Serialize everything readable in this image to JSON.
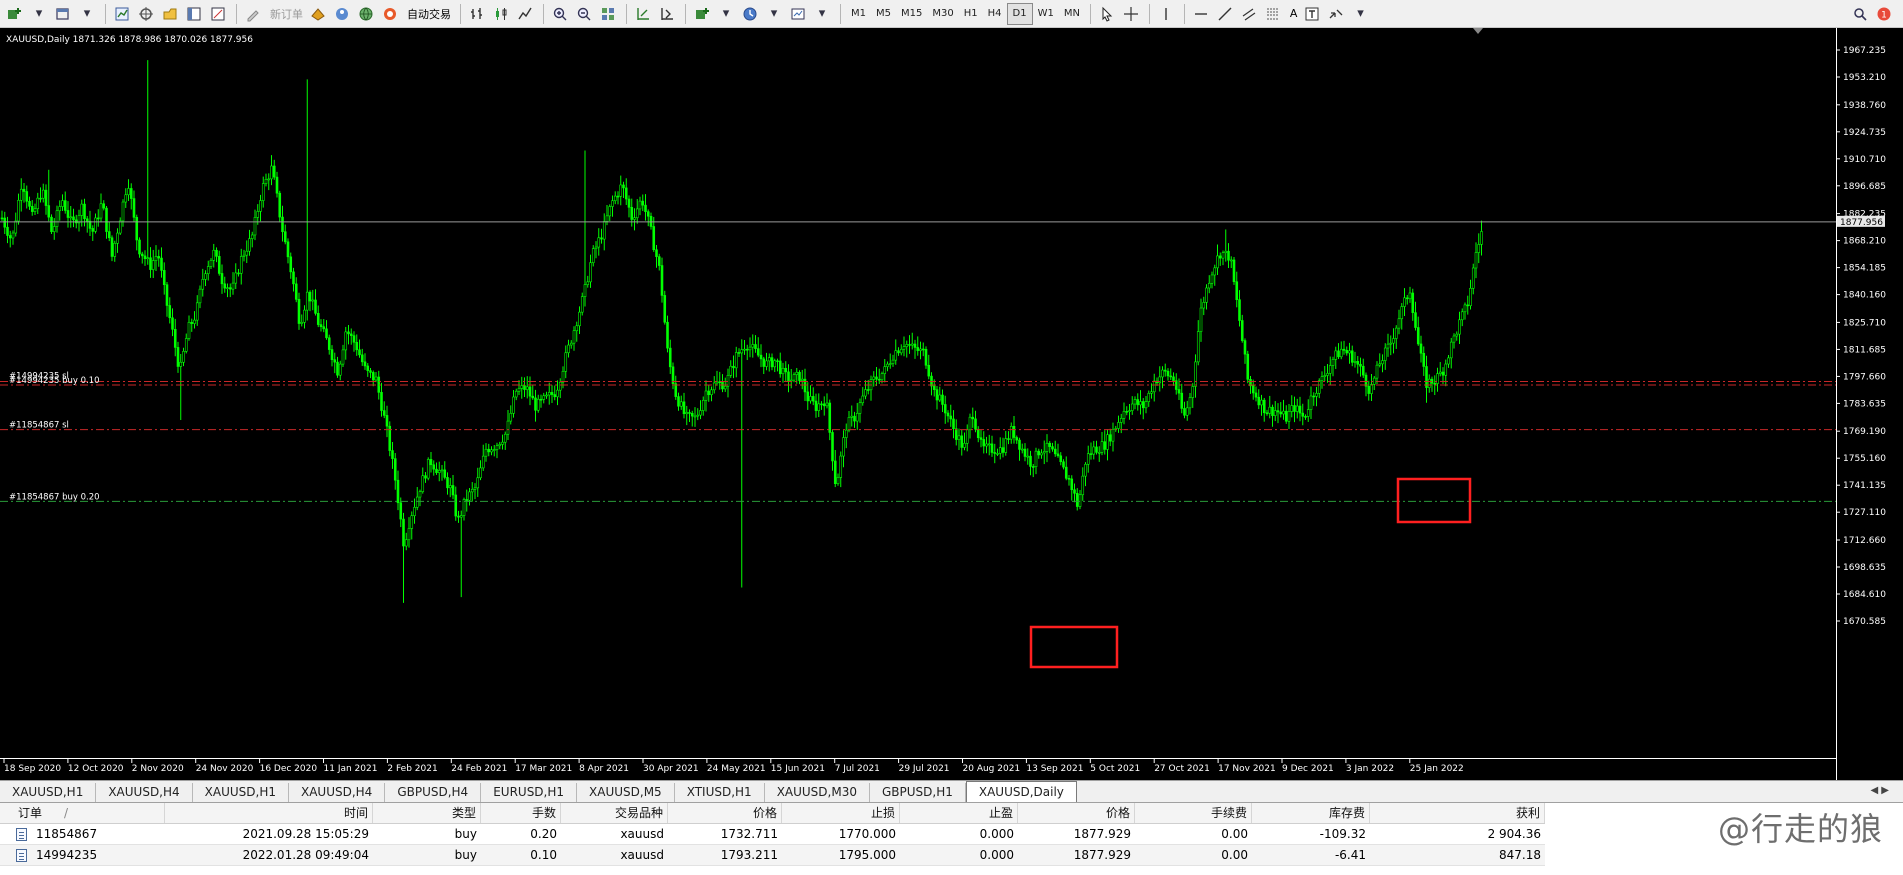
{
  "toolbar": {
    "new_order_label": "新订单",
    "auto_trading_label": "自动交易",
    "timeframes": [
      "M1",
      "M5",
      "M15",
      "M30",
      "H1",
      "H4",
      "D1",
      "W1",
      "MN"
    ],
    "active_timeframe": "D1",
    "text_tool_label": "A"
  },
  "chart": {
    "header": "XAUUSD,Daily  1871.326 1878.986 1870.026 1877.956",
    "current_price": "1877.956",
    "price_labels": [
      "1967.235",
      "1953.210",
      "1938.760",
      "1924.735",
      "1910.710",
      "1896.685",
      "1882.235",
      "1868.210",
      "1854.185",
      "1840.160",
      "1825.710",
      "1811.685",
      "1797.660",
      "1783.635",
      "1769.190",
      "1755.160",
      "1741.135",
      "1727.110",
      "1712.660",
      "1698.635",
      "1684.610",
      "1670.585"
    ],
    "date_labels": [
      "18 Sep 2020",
      "12 Oct 2020",
      "2 Nov 2020",
      "24 Nov 2020",
      "16 Dec 2020",
      "11 Jan 2021",
      "2 Feb 2021",
      "24 Feb 2021",
      "17 Mar 2021",
      "8 Apr 2021",
      "30 Apr 2021",
      "24 May 2021",
      "15 Jun 2021",
      "7 Jul 2021",
      "29 Jul 2021",
      "20 Aug 2021",
      "13 Sep 2021",
      "5 Oct 2021",
      "27 Oct 2021",
      "17 Nov 2021",
      "9 Dec 2021",
      "3 Jan 2022",
      "25 Jan 2022"
    ],
    "levels": [
      {
        "label": "#14994235 sl",
        "price": 1795.0,
        "color": "#c82828"
      },
      {
        "label": "#14994235 buy 0.10",
        "price": 1793.211,
        "color": "#c82828"
      },
      {
        "label": "#11854867 sl",
        "price": 1770.0,
        "color": "#c82828"
      },
      {
        "label": "#11854867 buy 0.20",
        "price": 1732.711,
        "color": "#2a9a3a"
      }
    ],
    "candle_color": "#00ff00",
    "price_line_color": "#aaaaaa",
    "highlight_color": "#ff2020"
  },
  "tabs": [
    "XAUUSD,H1",
    "XAUUSD,H4",
    "XAUUSD,H1",
    "XAUUSD,H4",
    "GBPUSD,H4",
    "EURUSD,H1",
    "XAUUSD,M5",
    "XTIUSD,H1",
    "XAUUSD,M30",
    "GBPUSD,H1",
    "XAUUSD,Daily"
  ],
  "active_tab": "XAUUSD,Daily",
  "orders": {
    "columns": [
      "订单",
      "/",
      "时间",
      "类型",
      "手数",
      "交易品种",
      "价格",
      "止损",
      "止盈",
      "价格",
      "手续费",
      "库存费",
      "获利"
    ],
    "rows": [
      [
        "11854867",
        "2021.09.28 15:05:29",
        "buy",
        "0.20",
        "xauusd",
        "1732.711",
        "1770.000",
        "0.000",
        "1877.929",
        "0.00",
        "-109.32",
        "2 904.36"
      ],
      [
        "14994235",
        "2022.01.28 09:49:04",
        "buy",
        "0.10",
        "xauusd",
        "1793.211",
        "1795.000",
        "0.000",
        "1877.929",
        "0.00",
        "-6.41",
        "847.18"
      ]
    ]
  },
  "watermark": "@行走的狼"
}
